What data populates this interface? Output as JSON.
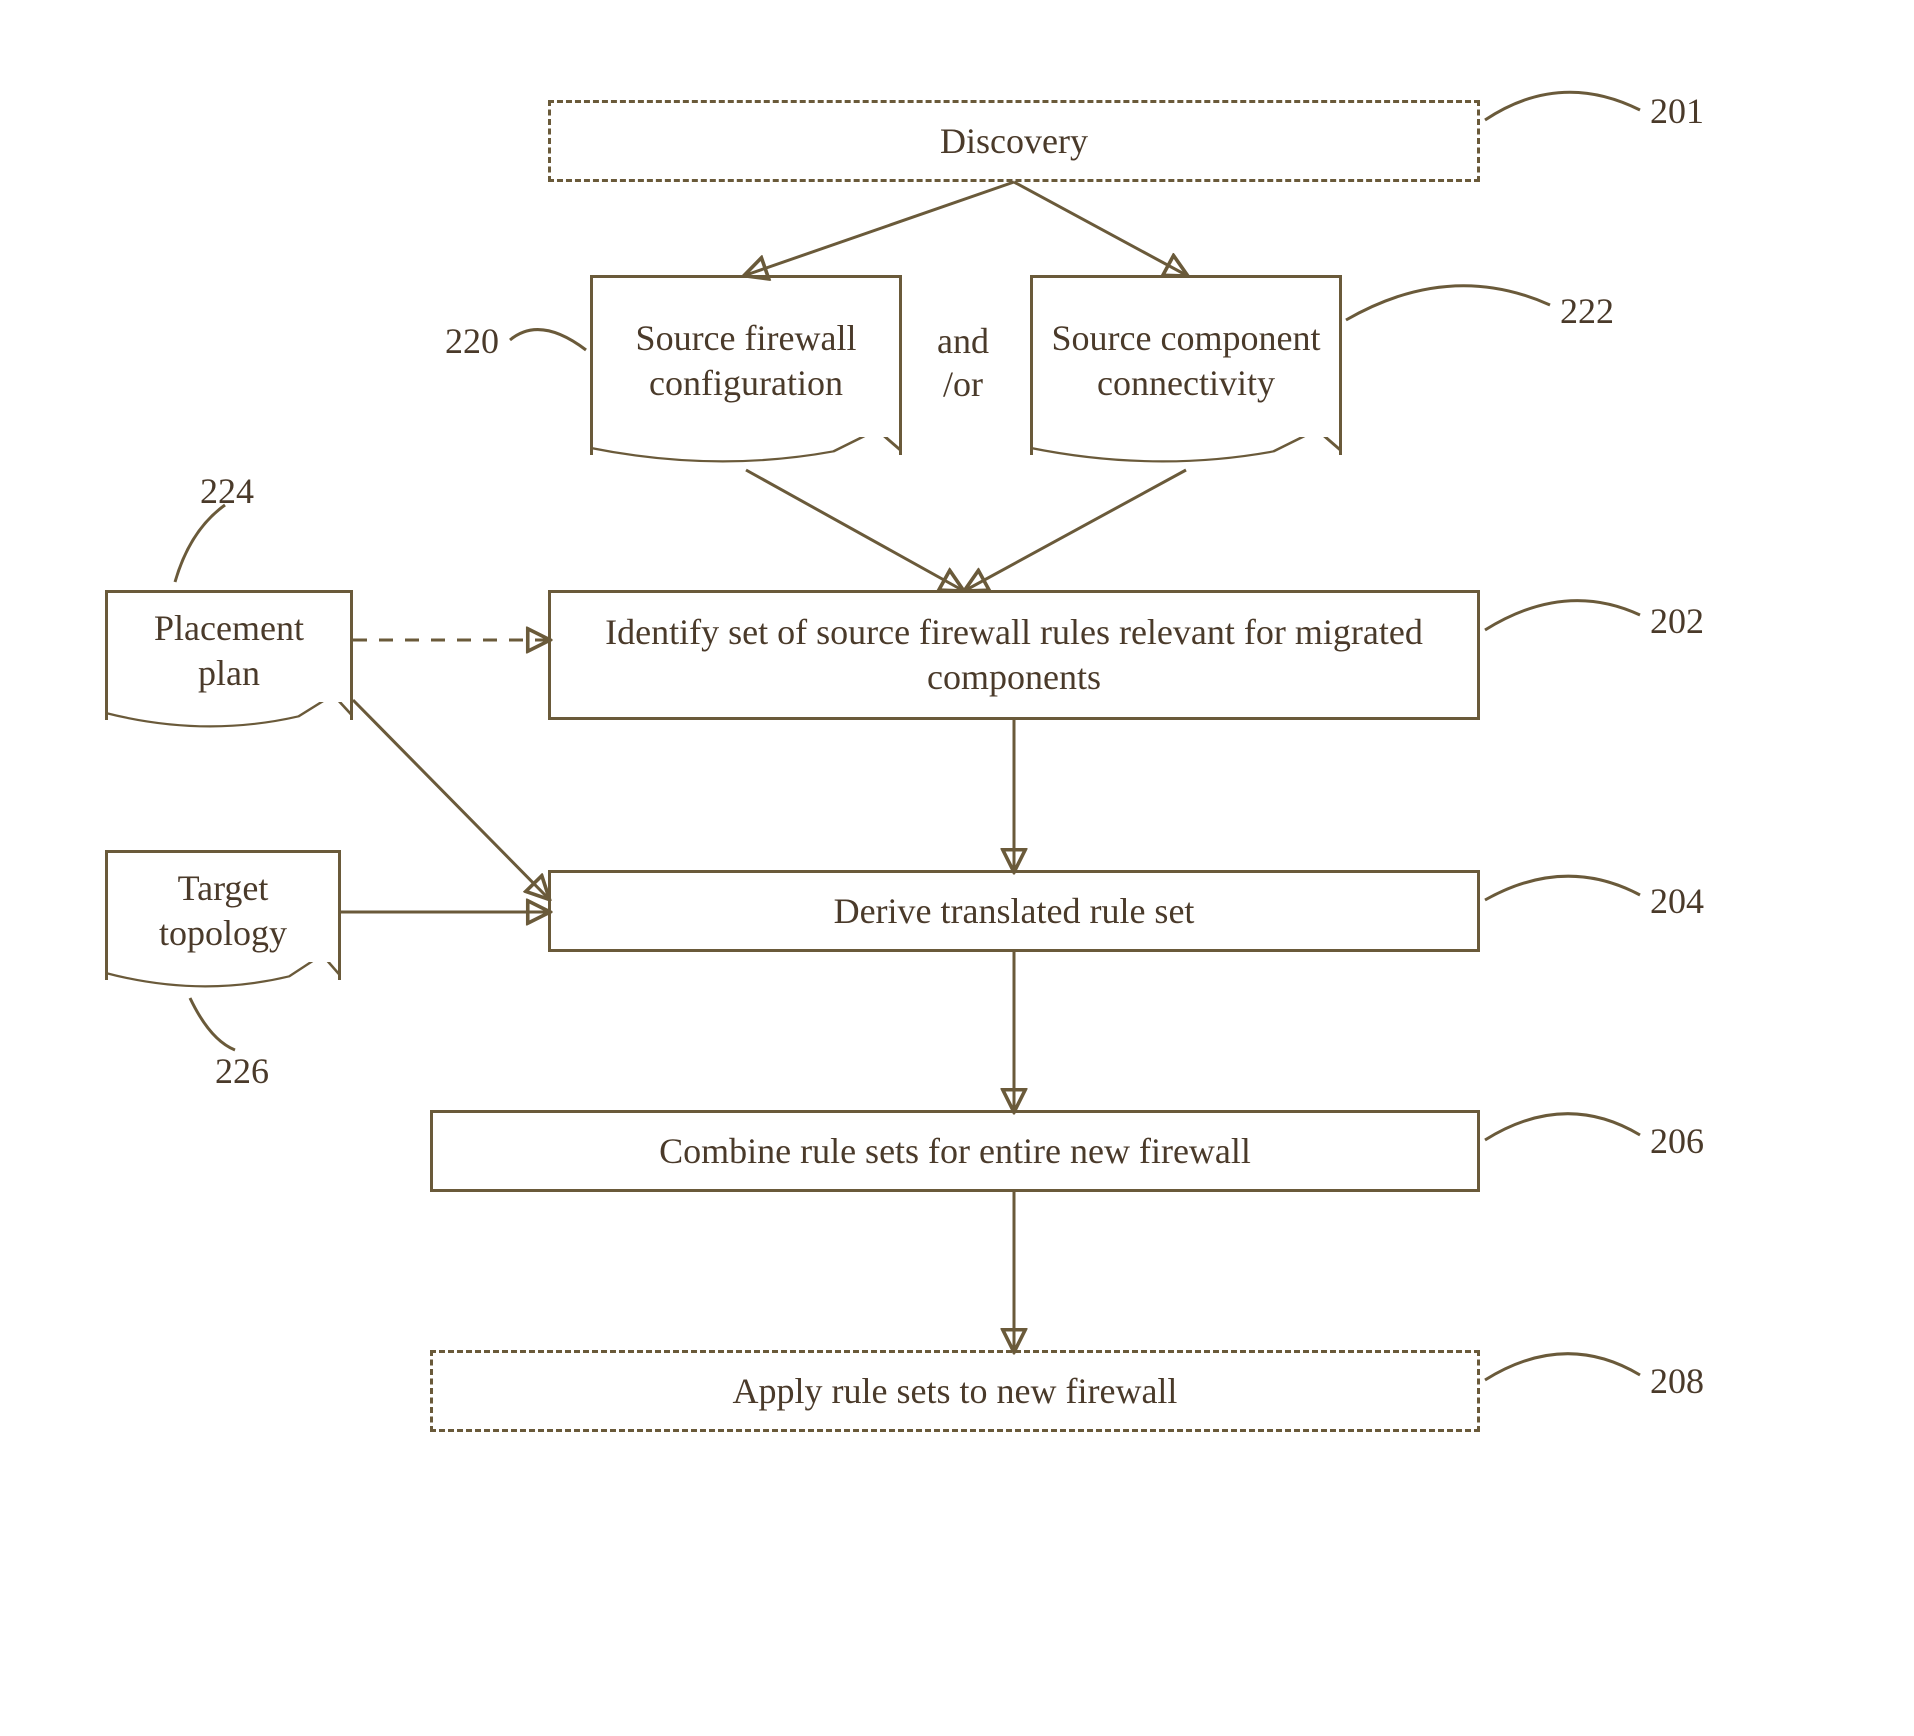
{
  "nodes": {
    "discovery": "Discovery",
    "src_fw_config": "Source firewall configuration",
    "src_comp_conn": "Source component connectivity",
    "and_or": "and /or",
    "placement_plan": "Placement plan",
    "target_topology": "Target topology",
    "identify_rules": "Identify set of source firewall rules relevant for migrated components",
    "derive_rules": "Derive translated rule set",
    "combine_rules": "Combine rule sets for entire new firewall",
    "apply_rules": "Apply rule sets to new firewall"
  },
  "labels": {
    "l201": "201",
    "l220": "220",
    "l222": "222",
    "l224": "224",
    "l226": "226",
    "l202": "202",
    "l204": "204",
    "l206": "206",
    "l208": "208"
  }
}
